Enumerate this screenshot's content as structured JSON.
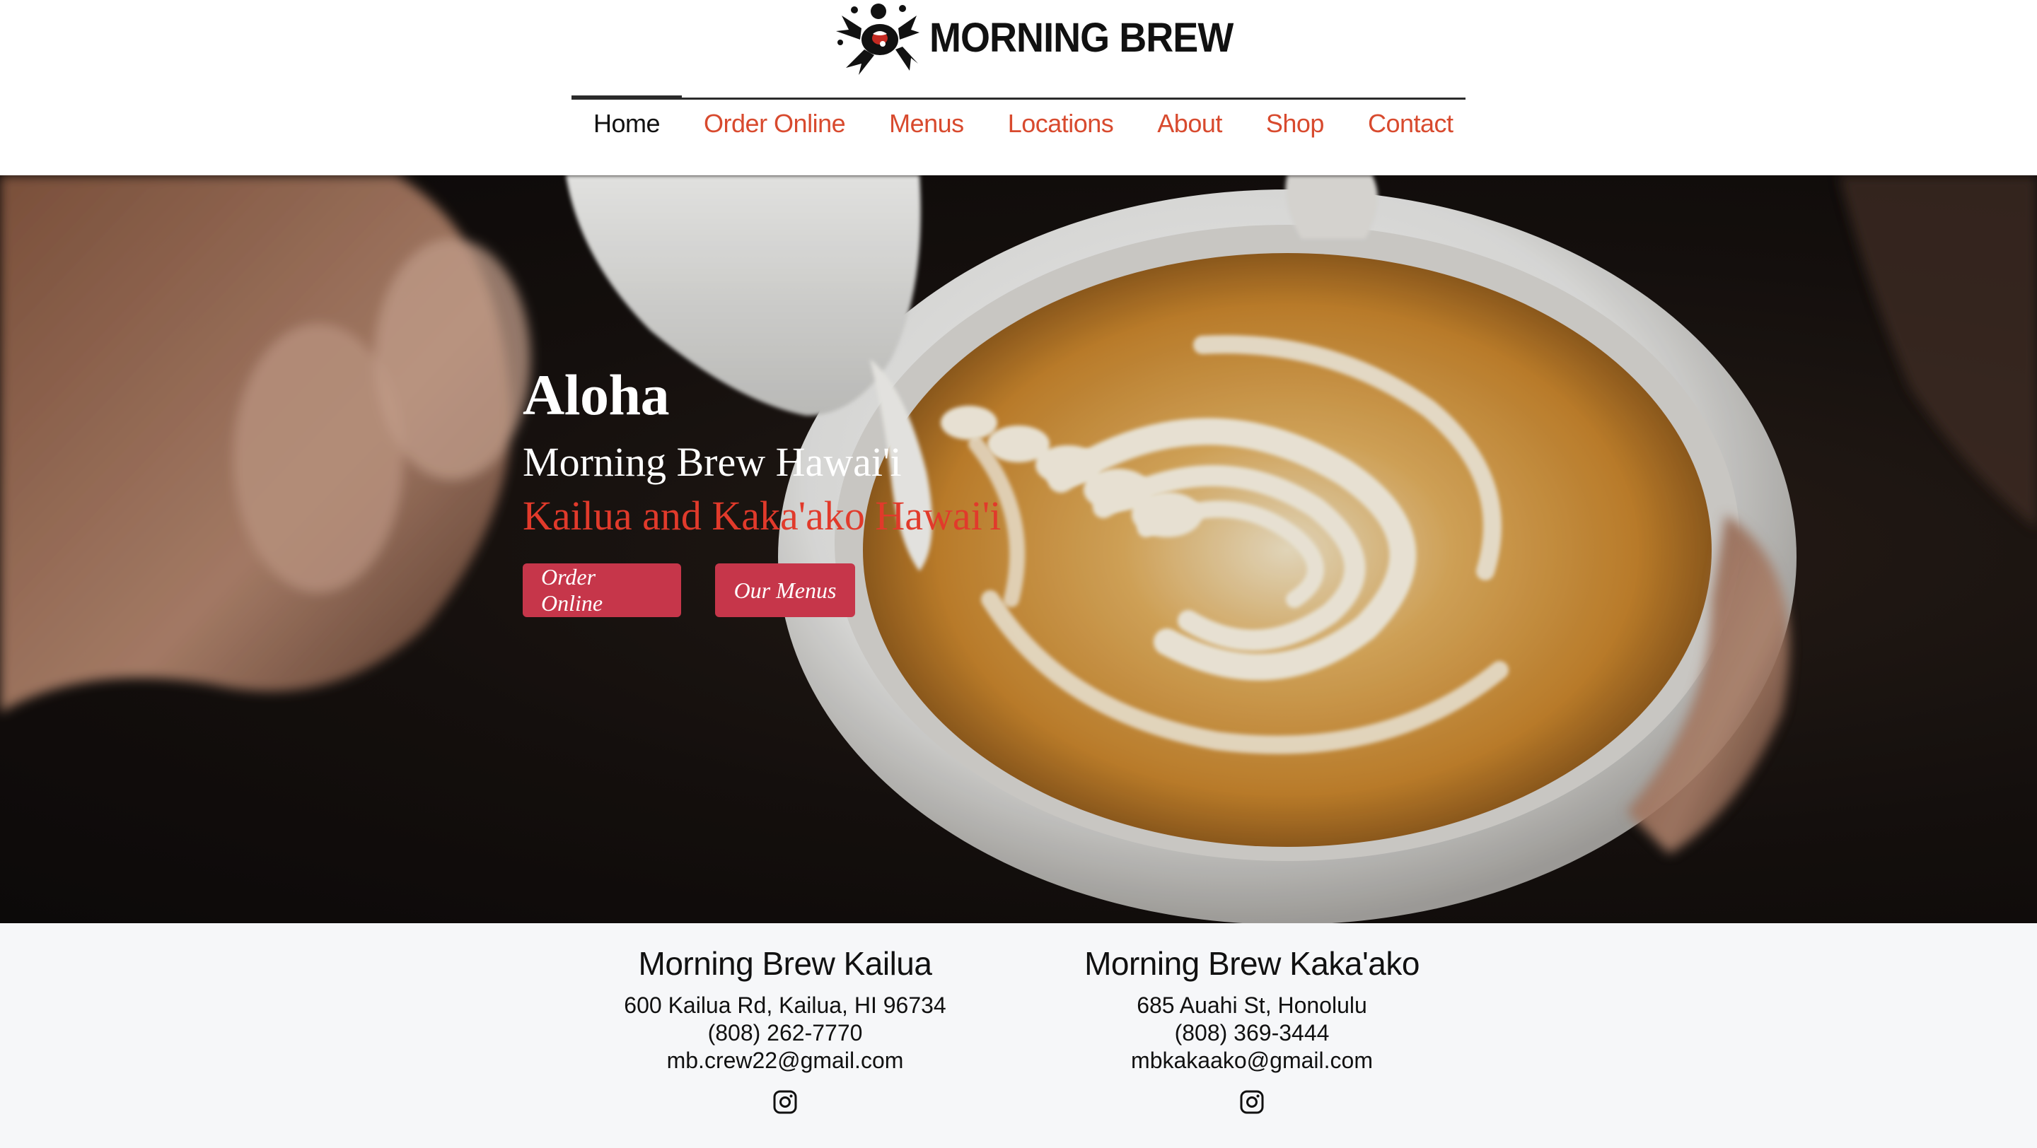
{
  "brand": {
    "name": "MORNING BREW",
    "logo_icon": "turtle-logo-icon"
  },
  "nav": {
    "items": [
      {
        "label": "Home",
        "active": true
      },
      {
        "label": "Order Online",
        "active": false
      },
      {
        "label": "Menus",
        "active": false
      },
      {
        "label": "Locations",
        "active": false
      },
      {
        "label": "About",
        "active": false
      },
      {
        "label": "Shop",
        "active": false
      },
      {
        "label": "Contact",
        "active": false
      }
    ],
    "active_color": "#111111",
    "link_color": "#d84a2e"
  },
  "hero": {
    "title": "Aloha",
    "subtitle": "Morning Brew Hawai'i",
    "location": "Kailua and Kaka'ako Hawai'i",
    "buttons": [
      {
        "label": "Order Online"
      },
      {
        "label": "Our Menus"
      }
    ],
    "button_color": "#c6364a",
    "accent_color": "#e13a2b"
  },
  "locations": [
    {
      "name": "Morning Brew Kailua",
      "address": "600 Kailua Rd, Kailua, HI 96734",
      "phone": "(808) 262-7770",
      "email": "mb.crew22@gmail.com",
      "social_icon": "instagram-icon"
    },
    {
      "name": "Morning Brew Kaka'ako",
      "address": "685 Auahi St, Honolulu",
      "phone": "(808) 369-3444",
      "email": "mbkakaako@gmail.com",
      "social_icon": "instagram-icon"
    }
  ]
}
